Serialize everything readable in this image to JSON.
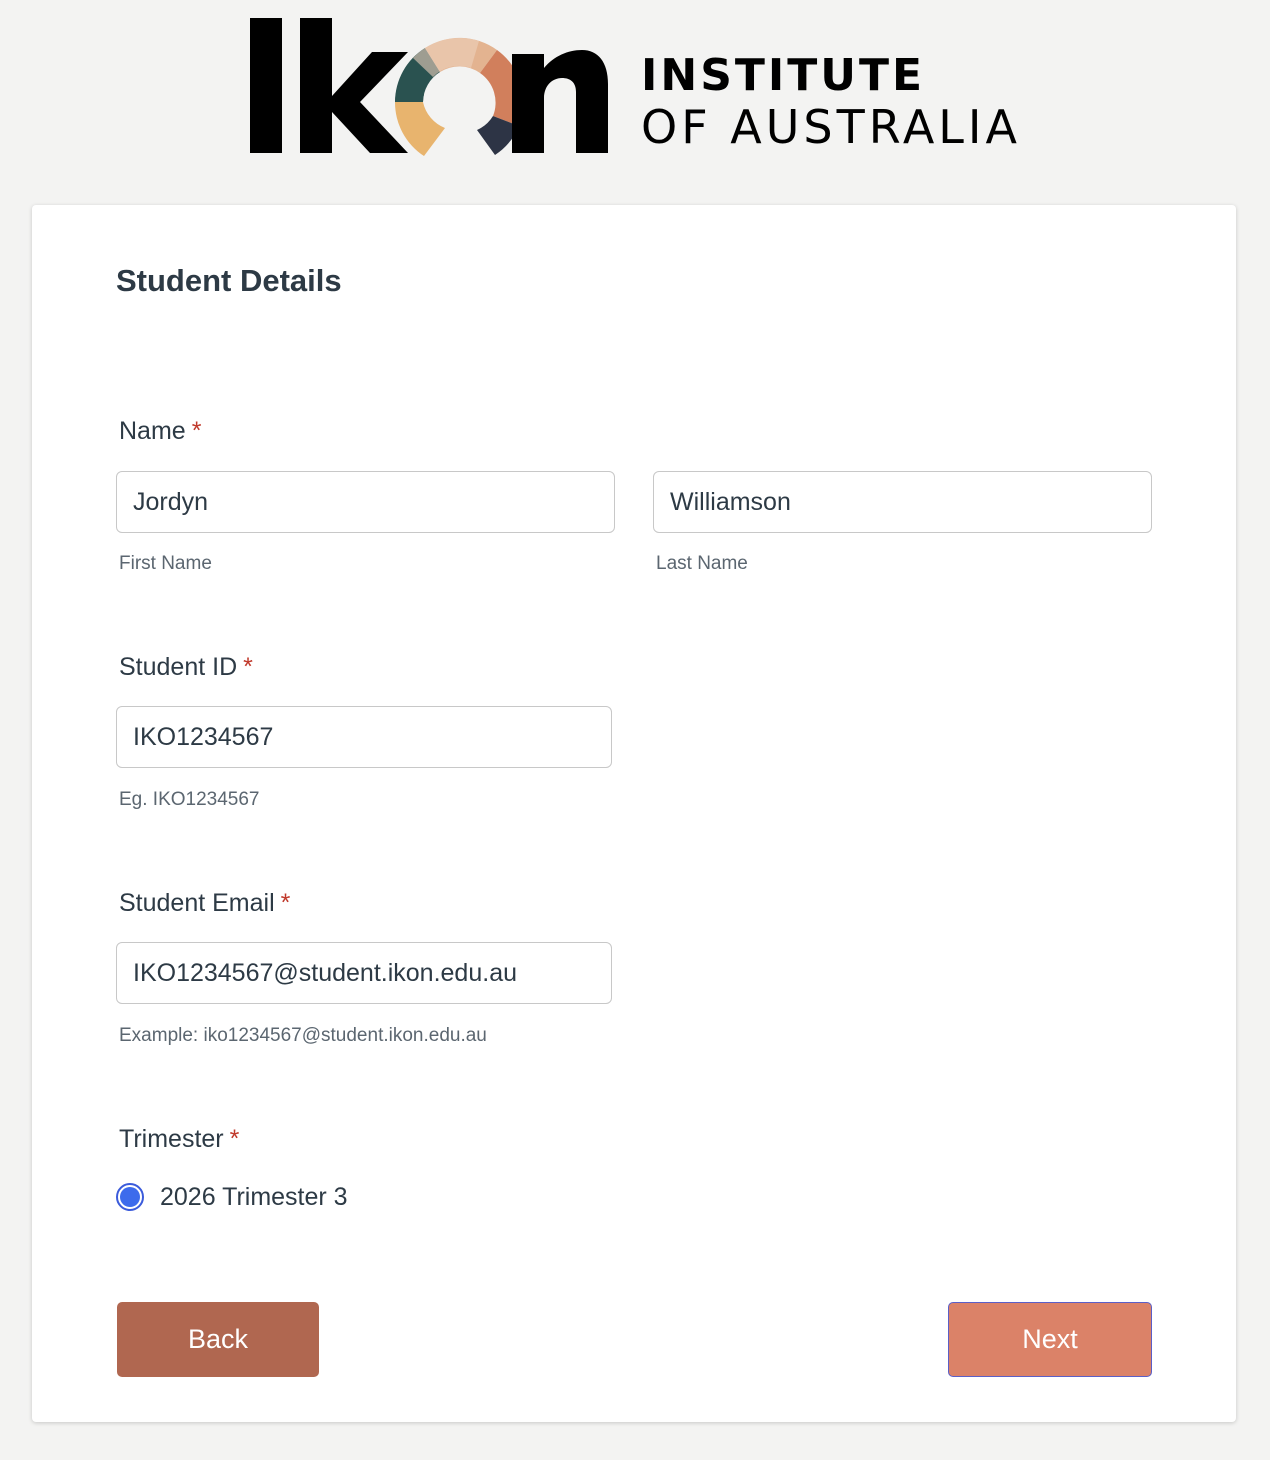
{
  "logo": {
    "wordmark": "Ikon",
    "line1": "INSTITUTE",
    "line2": "OF AUSTRALIA"
  },
  "form": {
    "title": "Student Details",
    "name": {
      "label": "Name",
      "required_mark": "*",
      "first_value": "Jordyn",
      "first_sublabel": "First Name",
      "last_value": "Williamson",
      "last_sublabel": "Last Name"
    },
    "student_id": {
      "label": "Student ID",
      "required_mark": "*",
      "value": "IKO1234567",
      "hint": "Eg. IKO1234567"
    },
    "student_email": {
      "label": "Student Email",
      "required_mark": "*",
      "value": "IKO1234567@student.ikon.edu.au",
      "hint": "Example: iko1234567@student.ikon.edu.au"
    },
    "trimester": {
      "label": "Trimester",
      "required_mark": "*",
      "option_label": "2026 Trimester 3",
      "selected": true
    }
  },
  "buttons": {
    "back": "Back",
    "next": "Next"
  },
  "colors": {
    "page_background": "#f3f3f2",
    "required": "#c0392b",
    "back_button": "#b06750",
    "next_button": "#db8268",
    "radio_selected": "#3d6bec",
    "logo_teal": "#2a5250",
    "logo_peach": "#e3b390",
    "logo_terracotta": "#d17f5c",
    "logo_navy": "#2d3445",
    "logo_yellow": "#e8b46e"
  }
}
